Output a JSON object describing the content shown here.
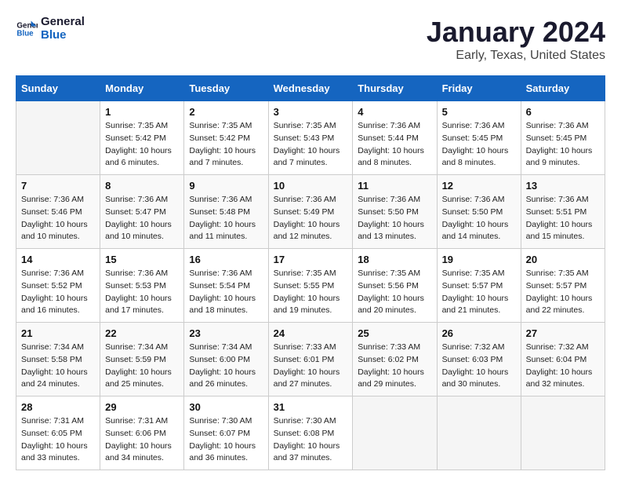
{
  "logo": {
    "text_general": "General",
    "text_blue": "Blue"
  },
  "title": "January 2024",
  "subtitle": "Early, Texas, United States",
  "headers": [
    "Sunday",
    "Monday",
    "Tuesday",
    "Wednesday",
    "Thursday",
    "Friday",
    "Saturday"
  ],
  "weeks": [
    [
      {
        "day": "",
        "sunrise": "",
        "sunset": "",
        "daylight": ""
      },
      {
        "day": "1",
        "sunrise": "Sunrise: 7:35 AM",
        "sunset": "Sunset: 5:42 PM",
        "daylight": "Daylight: 10 hours and 6 minutes."
      },
      {
        "day": "2",
        "sunrise": "Sunrise: 7:35 AM",
        "sunset": "Sunset: 5:42 PM",
        "daylight": "Daylight: 10 hours and 7 minutes."
      },
      {
        "day": "3",
        "sunrise": "Sunrise: 7:35 AM",
        "sunset": "Sunset: 5:43 PM",
        "daylight": "Daylight: 10 hours and 7 minutes."
      },
      {
        "day": "4",
        "sunrise": "Sunrise: 7:36 AM",
        "sunset": "Sunset: 5:44 PM",
        "daylight": "Daylight: 10 hours and 8 minutes."
      },
      {
        "day": "5",
        "sunrise": "Sunrise: 7:36 AM",
        "sunset": "Sunset: 5:45 PM",
        "daylight": "Daylight: 10 hours and 8 minutes."
      },
      {
        "day": "6",
        "sunrise": "Sunrise: 7:36 AM",
        "sunset": "Sunset: 5:45 PM",
        "daylight": "Daylight: 10 hours and 9 minutes."
      }
    ],
    [
      {
        "day": "7",
        "sunrise": "Sunrise: 7:36 AM",
        "sunset": "Sunset: 5:46 PM",
        "daylight": "Daylight: 10 hours and 10 minutes."
      },
      {
        "day": "8",
        "sunrise": "Sunrise: 7:36 AM",
        "sunset": "Sunset: 5:47 PM",
        "daylight": "Daylight: 10 hours and 10 minutes."
      },
      {
        "day": "9",
        "sunrise": "Sunrise: 7:36 AM",
        "sunset": "Sunset: 5:48 PM",
        "daylight": "Daylight: 10 hours and 11 minutes."
      },
      {
        "day": "10",
        "sunrise": "Sunrise: 7:36 AM",
        "sunset": "Sunset: 5:49 PM",
        "daylight": "Daylight: 10 hours and 12 minutes."
      },
      {
        "day": "11",
        "sunrise": "Sunrise: 7:36 AM",
        "sunset": "Sunset: 5:50 PM",
        "daylight": "Daylight: 10 hours and 13 minutes."
      },
      {
        "day": "12",
        "sunrise": "Sunrise: 7:36 AM",
        "sunset": "Sunset: 5:50 PM",
        "daylight": "Daylight: 10 hours and 14 minutes."
      },
      {
        "day": "13",
        "sunrise": "Sunrise: 7:36 AM",
        "sunset": "Sunset: 5:51 PM",
        "daylight": "Daylight: 10 hours and 15 minutes."
      }
    ],
    [
      {
        "day": "14",
        "sunrise": "Sunrise: 7:36 AM",
        "sunset": "Sunset: 5:52 PM",
        "daylight": "Daylight: 10 hours and 16 minutes."
      },
      {
        "day": "15",
        "sunrise": "Sunrise: 7:36 AM",
        "sunset": "Sunset: 5:53 PM",
        "daylight": "Daylight: 10 hours and 17 minutes."
      },
      {
        "day": "16",
        "sunrise": "Sunrise: 7:36 AM",
        "sunset": "Sunset: 5:54 PM",
        "daylight": "Daylight: 10 hours and 18 minutes."
      },
      {
        "day": "17",
        "sunrise": "Sunrise: 7:35 AM",
        "sunset": "Sunset: 5:55 PM",
        "daylight": "Daylight: 10 hours and 19 minutes."
      },
      {
        "day": "18",
        "sunrise": "Sunrise: 7:35 AM",
        "sunset": "Sunset: 5:56 PM",
        "daylight": "Daylight: 10 hours and 20 minutes."
      },
      {
        "day": "19",
        "sunrise": "Sunrise: 7:35 AM",
        "sunset": "Sunset: 5:57 PM",
        "daylight": "Daylight: 10 hours and 21 minutes."
      },
      {
        "day": "20",
        "sunrise": "Sunrise: 7:35 AM",
        "sunset": "Sunset: 5:57 PM",
        "daylight": "Daylight: 10 hours and 22 minutes."
      }
    ],
    [
      {
        "day": "21",
        "sunrise": "Sunrise: 7:34 AM",
        "sunset": "Sunset: 5:58 PM",
        "daylight": "Daylight: 10 hours and 24 minutes."
      },
      {
        "day": "22",
        "sunrise": "Sunrise: 7:34 AM",
        "sunset": "Sunset: 5:59 PM",
        "daylight": "Daylight: 10 hours and 25 minutes."
      },
      {
        "day": "23",
        "sunrise": "Sunrise: 7:34 AM",
        "sunset": "Sunset: 6:00 PM",
        "daylight": "Daylight: 10 hours and 26 minutes."
      },
      {
        "day": "24",
        "sunrise": "Sunrise: 7:33 AM",
        "sunset": "Sunset: 6:01 PM",
        "daylight": "Daylight: 10 hours and 27 minutes."
      },
      {
        "day": "25",
        "sunrise": "Sunrise: 7:33 AM",
        "sunset": "Sunset: 6:02 PM",
        "daylight": "Daylight: 10 hours and 29 minutes."
      },
      {
        "day": "26",
        "sunrise": "Sunrise: 7:32 AM",
        "sunset": "Sunset: 6:03 PM",
        "daylight": "Daylight: 10 hours and 30 minutes."
      },
      {
        "day": "27",
        "sunrise": "Sunrise: 7:32 AM",
        "sunset": "Sunset: 6:04 PM",
        "daylight": "Daylight: 10 hours and 32 minutes."
      }
    ],
    [
      {
        "day": "28",
        "sunrise": "Sunrise: 7:31 AM",
        "sunset": "Sunset: 6:05 PM",
        "daylight": "Daylight: 10 hours and 33 minutes."
      },
      {
        "day": "29",
        "sunrise": "Sunrise: 7:31 AM",
        "sunset": "Sunset: 6:06 PM",
        "daylight": "Daylight: 10 hours and 34 minutes."
      },
      {
        "day": "30",
        "sunrise": "Sunrise: 7:30 AM",
        "sunset": "Sunset: 6:07 PM",
        "daylight": "Daylight: 10 hours and 36 minutes."
      },
      {
        "day": "31",
        "sunrise": "Sunrise: 7:30 AM",
        "sunset": "Sunset: 6:08 PM",
        "daylight": "Daylight: 10 hours and 37 minutes."
      },
      {
        "day": "",
        "sunrise": "",
        "sunset": "",
        "daylight": ""
      },
      {
        "day": "",
        "sunrise": "",
        "sunset": "",
        "daylight": ""
      },
      {
        "day": "",
        "sunrise": "",
        "sunset": "",
        "daylight": ""
      }
    ]
  ]
}
